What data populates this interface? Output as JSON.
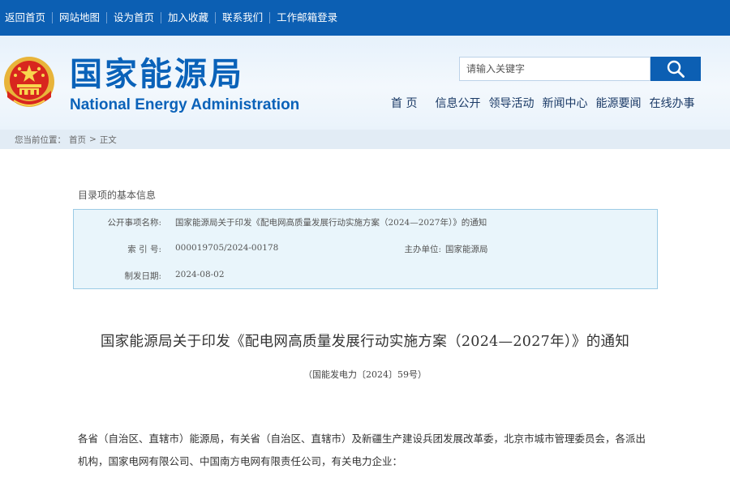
{
  "topnav": [
    "返回首页",
    "网站地图",
    "设为首页",
    "加入收藏",
    "联系我们",
    "工作邮箱登录"
  ],
  "logo": {
    "cn": "国家能源局",
    "en": "National Energy Administration"
  },
  "search": {
    "placeholder": "请输入关键字",
    "icon": "search-icon"
  },
  "mainnav": [
    "首 页",
    "信息公开",
    "领导活动",
    "新闻中心",
    "能源要闻",
    "在线办事"
  ],
  "breadcrumb": {
    "prefix": "您当前位置：",
    "items": [
      "首页",
      "正文"
    ],
    "sep": ">"
  },
  "info": {
    "box_title": "目录项的基本信息",
    "name_label": "公开事项名称:",
    "name_value": "国家能源局关于印发《配电网高质量发展行动实施方案（2024—2027年）》的通知",
    "index_label": "索 引 号:",
    "index_value": "000019705/2024-00178",
    "unit_label": "主办单位:",
    "unit_value": "国家能源局",
    "date_label": "制发日期:",
    "date_value": "2024-08-02"
  },
  "document": {
    "title": "国家能源局关于印发《配电网高质量发展行动实施方案（2024—2027年）》的通知",
    "number": "（国能发电力〔2024〕59号）",
    "para1": "各省（自治区、直辖市）能源局，有关省（自治区、直辖市）及新疆生产建设兵团发展改革委，北京市城市管理委员会，各派出",
    "para2": "机构，国家电网有限公司、中国南方电网有限责任公司，有关电力企业："
  },
  "colors": {
    "brand": "#0c5fb3",
    "logo_text": "#0a62b9",
    "info_bg": "#e9f5fb",
    "info_border": "#9ccbe5"
  }
}
